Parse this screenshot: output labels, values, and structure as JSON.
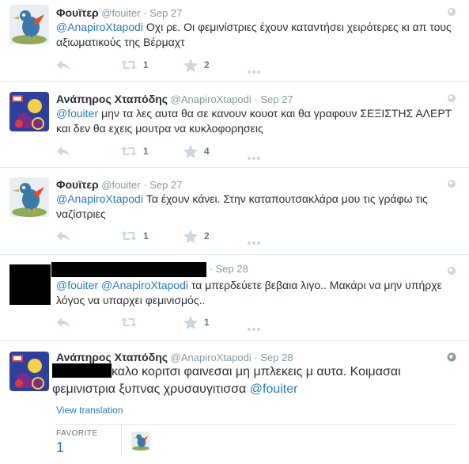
{
  "tweets": [
    {
      "name": "Φουϊτερ",
      "handle": "@fouiter",
      "date": "Sep 27",
      "avatar": "bird-avatar",
      "mentions": "@AnapiroXtapodi",
      "body": " Οχι ρε. Οι φεμινίστριες έχουν καταντήσει χειρότερες κι απ τους αξιωματικούς της Βέρμαχτ",
      "retweets": "1",
      "favorites": "2"
    },
    {
      "name": "Ανάπηρος Χταπόδης",
      "handle": "@AnapiroXtapodi",
      "date": "Sep 27",
      "avatar": "octopus-avatar",
      "mentions": "@fouiter",
      "body": " μην τα λες αυτα θα σε κανουν κουοτ και θα γραφουν ΣΕΞΙΣΤΗΣ ΑΛΕΡΤ και δεν θα εχεις μουτρα να κυκλοφορησεις",
      "retweets": "1",
      "favorites": "4"
    },
    {
      "name": "Φουϊτερ",
      "handle": "@fouiter",
      "date": "Sep 27",
      "avatar": "bird-avatar",
      "mentions": "@AnapiroXtapodi",
      "body": " Τα έχουν κάνει. Στην καταπουτσακλάρα μου τις γράφω τις ναζίστριες",
      "retweets": "1",
      "favorites": "2"
    },
    {
      "date": "Sep 28",
      "mention1": "@fouiter",
      "mention2": "@AnapiroXtapodi",
      "body": " τα μπερδεύετε βεβαια λιγο.. Μακάρι να μην υπήρχε λόγος να υπαρχει φεμινισμός..",
      "retweets": "",
      "favorites": "1"
    }
  ],
  "main_tweet": {
    "name": "Ανάπηρος Χταπόδης",
    "handle": "@AnapiroXtapodi",
    "date": "Sep 28",
    "body": "καλο κοριτσι φαινεσαι μη μπλεκεις μ αυτα. Κοιμασαι φεμινιστρια ξυπνας χρυσαυγιτισσα ",
    "mention": "@fouiter",
    "translate_link": "View translation",
    "favorite_label": "FAVORITE",
    "favorite_count": "1"
  },
  "colors": {
    "link": "#2b7bb9",
    "muted": "#8899a6",
    "action_icon": "#ccd6dd"
  }
}
